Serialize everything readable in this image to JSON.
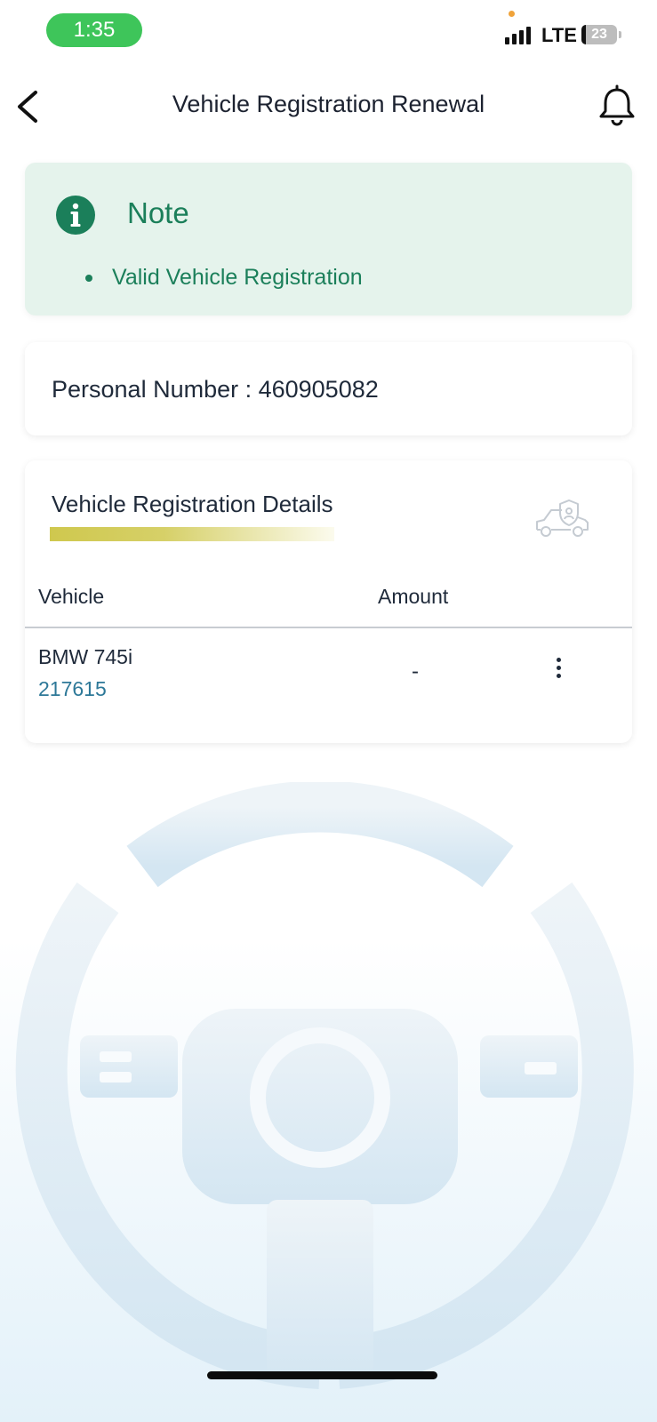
{
  "status_bar": {
    "time": "1:35",
    "network": "LTE",
    "battery": "23",
    "colors": {
      "time_pill": "#3ec55a",
      "privacy_dot": "#f0a33a"
    }
  },
  "header": {
    "title": "Vehicle Registration Renewal",
    "icons": {
      "back": "chevron-left-icon",
      "notifications": "bell-icon"
    }
  },
  "note": {
    "title": "Note",
    "items": [
      "Valid Vehicle Registration"
    ],
    "icon": "info-icon",
    "colors": {
      "background": "#e5f3ec",
      "accent": "#1b7f5a"
    }
  },
  "personal": {
    "text": "Personal Number : 460905082"
  },
  "details": {
    "title": "Vehicle Registration Details",
    "icon": "car-shield-icon",
    "columns": {
      "vehicle": "Vehicle",
      "amount": "Amount"
    },
    "rows": [
      {
        "name": "BMW 745i",
        "plate": "217615",
        "amount": "-"
      }
    ],
    "colors": {
      "plate": "#2d7898",
      "title_bar": "#cfc84e"
    }
  },
  "background": {
    "icon": "steering-wheel-icon"
  }
}
